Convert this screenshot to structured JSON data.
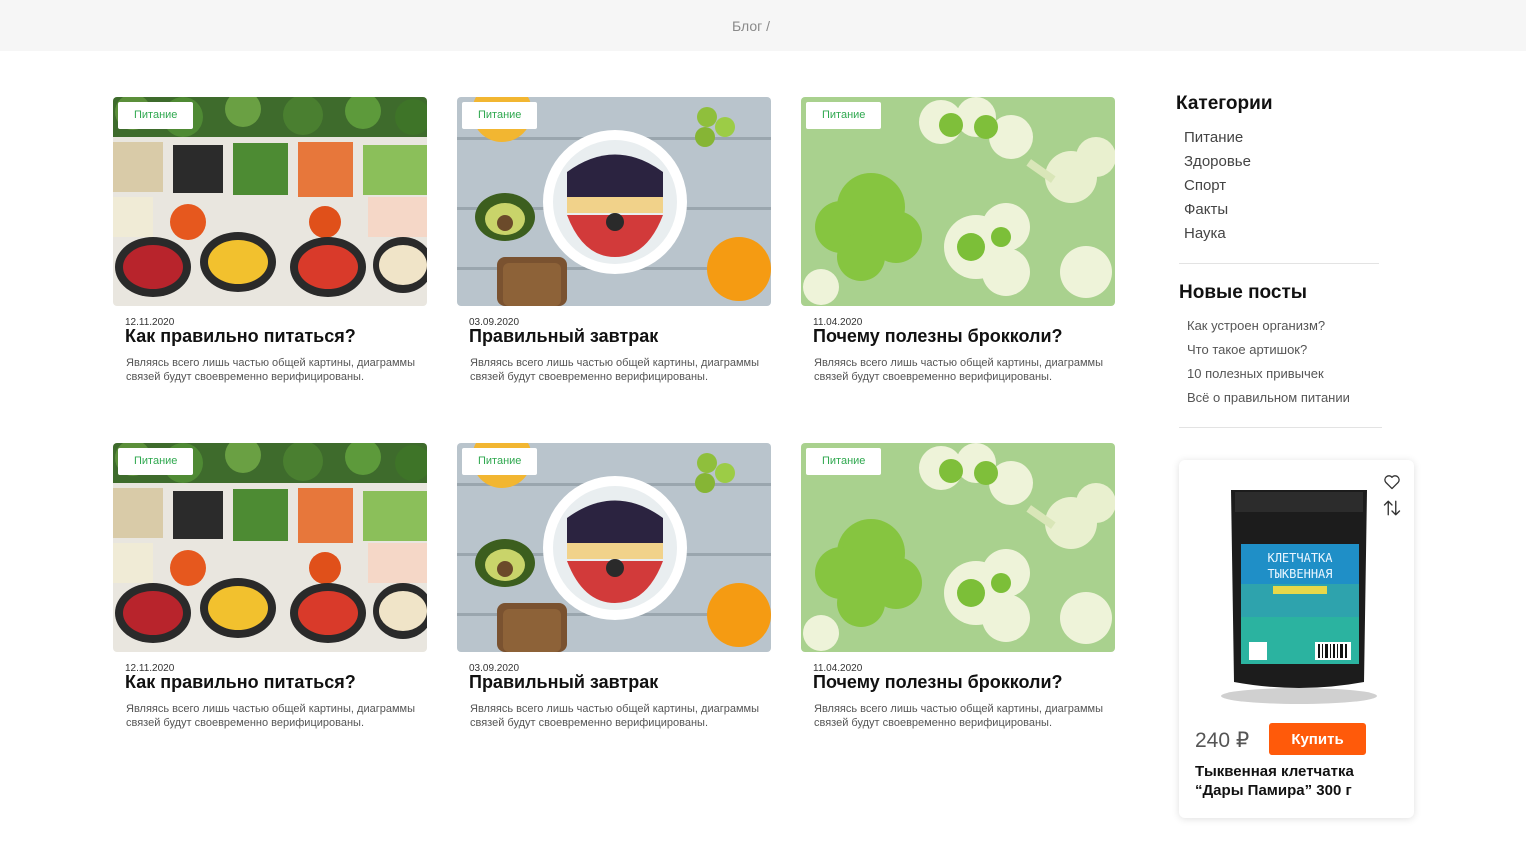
{
  "breadcrumb": "Блог /",
  "posts": [
    {
      "tag": "Питание",
      "date": "12.11.2020",
      "title": "Как правильно питаться?",
      "excerpt": "Являясь всего лишь частью общей картины, диаграммы связей будут своевременно верифицированы."
    },
    {
      "tag": "Питание",
      "date": "03.09.2020",
      "title": "Правильный завтрак",
      "excerpt": "Являясь всего лишь частью общей картины, диаграммы связей будут своевременно верифицированы."
    },
    {
      "tag": "Питание",
      "date": "11.04.2020",
      "title": "Почему полезны брокколи?",
      "excerpt": "Являясь всего лишь частью общей картины, диаграммы связей будут своевременно верифицированы."
    },
    {
      "tag": "Питание",
      "date": "12.11.2020",
      "title": "Как правильно питаться?",
      "excerpt": "Являясь всего лишь частью общей картины, диаграммы связей будут своевременно верифицированы."
    },
    {
      "tag": "Питание",
      "date": "03.09.2020",
      "title": "Правильный завтрак",
      "excerpt": "Являясь всего лишь частью общей картины, диаграммы связей будут своевременно верифицированы."
    },
    {
      "tag": "Питание",
      "date": "11.04.2020",
      "title": "Почему полезны брокколи?",
      "excerpt": "Являясь всего лишь частью общей картины, диаграммы связей будут своевременно верифицированы."
    }
  ],
  "sidebar": {
    "categories_title": "Категории",
    "categories": [
      "Питание",
      "Здоровье",
      "Спорт",
      "Факты",
      "Наука"
    ],
    "new_posts_title": "Новые посты",
    "new_posts": [
      "Как устроен организм?",
      "Что такое артишок?",
      "10 полезных привычек",
      "Всё о правильном питании"
    ]
  },
  "product": {
    "price": "240 ₽",
    "buy_label": "Купить",
    "name": "Тыквенная клетчатка “Дары Памира” 300 г",
    "pack_text": [
      "КЛЕТЧАТКА",
      "ТЫКВЕННАЯ"
    ],
    "favorite_icon": "heart-icon",
    "compare_icon": "compare-arrows-icon"
  },
  "colors": {
    "tag_text": "#2fa84f",
    "buy_button": "#ff5a0a",
    "topbar": "#f6f6f6"
  }
}
